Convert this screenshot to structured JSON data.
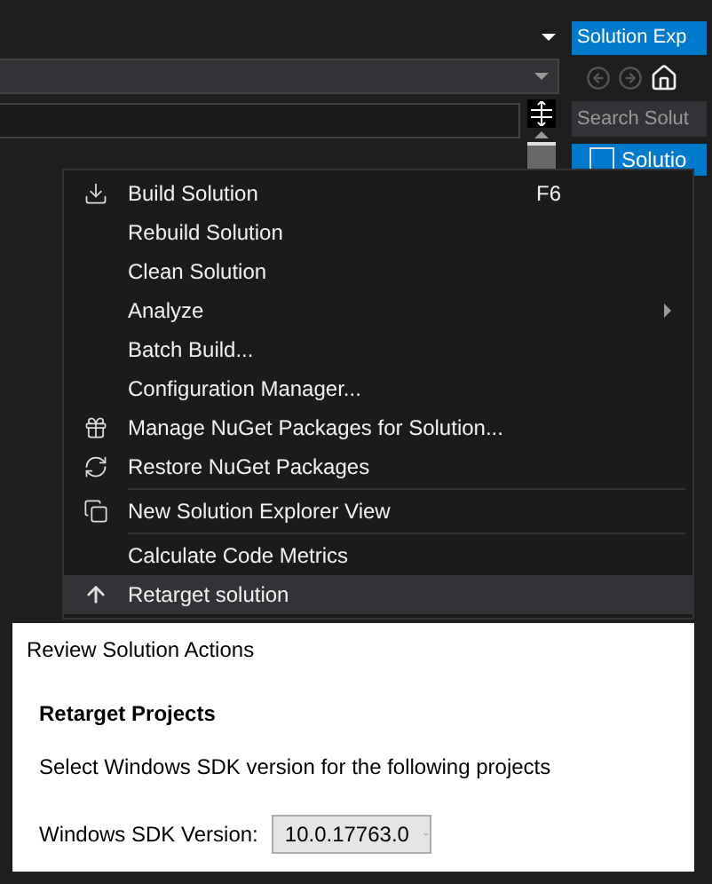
{
  "solution_explorer": {
    "title": "Solution Exp",
    "search": {
      "placeholder": "Search Solut"
    },
    "items": [
      {
        "label": "Solutio",
        "selected": true
      }
    ]
  },
  "context_menu": {
    "items": [
      {
        "kind": "build",
        "label": "Build Solution",
        "shortcut": "F6",
        "selected": false
      },
      {
        "kind": "plain",
        "label": "Rebuild Solution",
        "selected": false
      },
      {
        "kind": "plain",
        "label": "Clean Solution",
        "selected": false
      },
      {
        "kind": "plain",
        "label": "Analyze",
        "submenu": true,
        "selected": false
      },
      {
        "kind": "plain",
        "label": "Batch Build...",
        "selected": false
      },
      {
        "kind": "plain",
        "label": "Configuration Manager...",
        "selected": false
      },
      {
        "kind": "nuget",
        "label": "Manage NuGet Packages for Solution...",
        "selected": false
      },
      {
        "kind": "restore",
        "label": "Restore NuGet Packages",
        "selected": false
      },
      {
        "kind": "separator"
      },
      {
        "kind": "view",
        "label": "New Solution Explorer View",
        "selected": false
      },
      {
        "kind": "separator"
      },
      {
        "kind": "plain",
        "label": "Calculate Code Metrics",
        "selected": false
      },
      {
        "kind": "retarget",
        "label": "Retarget solution",
        "selected": true
      }
    ]
  },
  "dialog": {
    "title": "Review Solution Actions",
    "heading": "Retarget Projects",
    "description": "Select Windows SDK version for the following projects",
    "field": {
      "label": "Windows SDK Version:",
      "value": "10.0.17763.0"
    }
  }
}
